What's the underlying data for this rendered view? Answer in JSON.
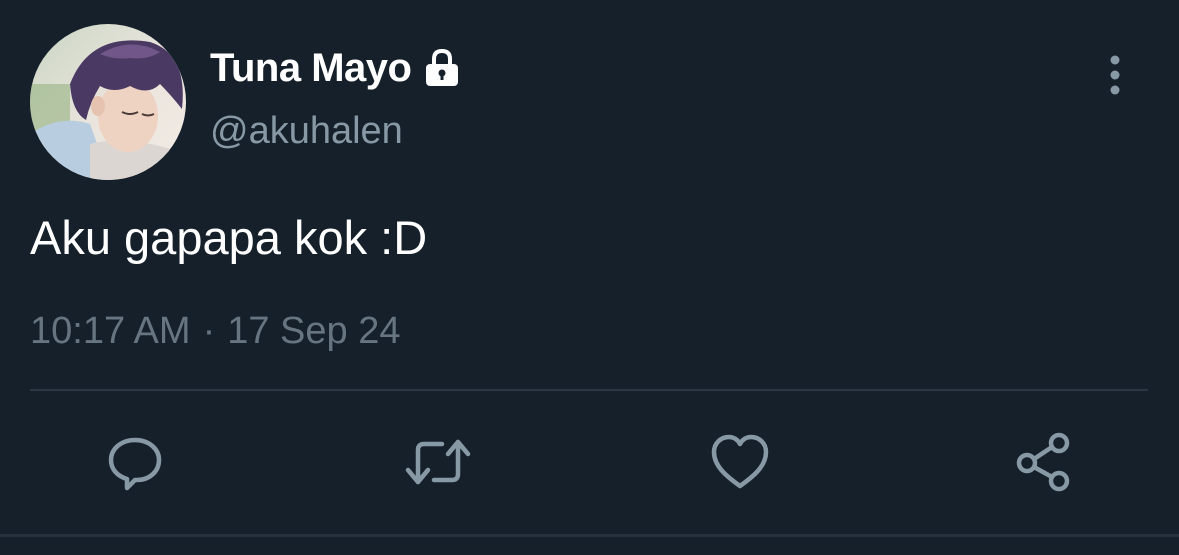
{
  "author": {
    "display_name": "Tuna Mayo",
    "handle": "@akuhalen",
    "protected_icon": "lock-icon",
    "avatar_icon": "profile-photo"
  },
  "tweet": {
    "text": "Aku gapapa kok :D",
    "time": "10:17 AM",
    "separator": "·",
    "date": "17 Sep 24"
  },
  "actions": [
    {
      "icon": "reply-icon"
    },
    {
      "icon": "retweet-icon"
    },
    {
      "icon": "like-icon"
    },
    {
      "icon": "share-icon"
    }
  ],
  "menu_icon": "more-vertical-icon",
  "colors": {
    "background": "#16202b",
    "primary_text": "#ffffff",
    "secondary_text": "#8899a6",
    "meta_text": "#66757f",
    "icon": "#8899a6",
    "divider": "#2a3642"
  }
}
